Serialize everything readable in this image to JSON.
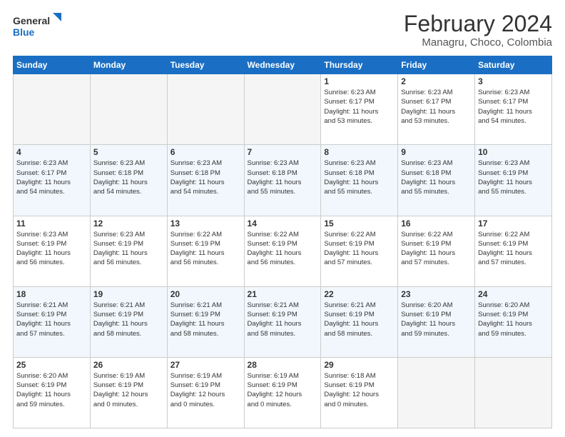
{
  "logo": {
    "text_general": "General",
    "text_blue": "Blue"
  },
  "header": {
    "title": "February 2024",
    "subtitle": "Managru, Choco, Colombia"
  },
  "weekdays": [
    "Sunday",
    "Monday",
    "Tuesday",
    "Wednesday",
    "Thursday",
    "Friday",
    "Saturday"
  ],
  "weeks": [
    [
      {
        "day": "",
        "info": ""
      },
      {
        "day": "",
        "info": ""
      },
      {
        "day": "",
        "info": ""
      },
      {
        "day": "",
        "info": ""
      },
      {
        "day": "1",
        "info": "Sunrise: 6:23 AM\nSunset: 6:17 PM\nDaylight: 11 hours\nand 53 minutes."
      },
      {
        "day": "2",
        "info": "Sunrise: 6:23 AM\nSunset: 6:17 PM\nDaylight: 11 hours\nand 53 minutes."
      },
      {
        "day": "3",
        "info": "Sunrise: 6:23 AM\nSunset: 6:17 PM\nDaylight: 11 hours\nand 54 minutes."
      }
    ],
    [
      {
        "day": "4",
        "info": "Sunrise: 6:23 AM\nSunset: 6:17 PM\nDaylight: 11 hours\nand 54 minutes."
      },
      {
        "day": "5",
        "info": "Sunrise: 6:23 AM\nSunset: 6:18 PM\nDaylight: 11 hours\nand 54 minutes."
      },
      {
        "day": "6",
        "info": "Sunrise: 6:23 AM\nSunset: 6:18 PM\nDaylight: 11 hours\nand 54 minutes."
      },
      {
        "day": "7",
        "info": "Sunrise: 6:23 AM\nSunset: 6:18 PM\nDaylight: 11 hours\nand 55 minutes."
      },
      {
        "day": "8",
        "info": "Sunrise: 6:23 AM\nSunset: 6:18 PM\nDaylight: 11 hours\nand 55 minutes."
      },
      {
        "day": "9",
        "info": "Sunrise: 6:23 AM\nSunset: 6:18 PM\nDaylight: 11 hours\nand 55 minutes."
      },
      {
        "day": "10",
        "info": "Sunrise: 6:23 AM\nSunset: 6:19 PM\nDaylight: 11 hours\nand 55 minutes."
      }
    ],
    [
      {
        "day": "11",
        "info": "Sunrise: 6:23 AM\nSunset: 6:19 PM\nDaylight: 11 hours\nand 56 minutes."
      },
      {
        "day": "12",
        "info": "Sunrise: 6:23 AM\nSunset: 6:19 PM\nDaylight: 11 hours\nand 56 minutes."
      },
      {
        "day": "13",
        "info": "Sunrise: 6:22 AM\nSunset: 6:19 PM\nDaylight: 11 hours\nand 56 minutes."
      },
      {
        "day": "14",
        "info": "Sunrise: 6:22 AM\nSunset: 6:19 PM\nDaylight: 11 hours\nand 56 minutes."
      },
      {
        "day": "15",
        "info": "Sunrise: 6:22 AM\nSunset: 6:19 PM\nDaylight: 11 hours\nand 57 minutes."
      },
      {
        "day": "16",
        "info": "Sunrise: 6:22 AM\nSunset: 6:19 PM\nDaylight: 11 hours\nand 57 minutes."
      },
      {
        "day": "17",
        "info": "Sunrise: 6:22 AM\nSunset: 6:19 PM\nDaylight: 11 hours\nand 57 minutes."
      }
    ],
    [
      {
        "day": "18",
        "info": "Sunrise: 6:21 AM\nSunset: 6:19 PM\nDaylight: 11 hours\nand 57 minutes."
      },
      {
        "day": "19",
        "info": "Sunrise: 6:21 AM\nSunset: 6:19 PM\nDaylight: 11 hours\nand 58 minutes."
      },
      {
        "day": "20",
        "info": "Sunrise: 6:21 AM\nSunset: 6:19 PM\nDaylight: 11 hours\nand 58 minutes."
      },
      {
        "day": "21",
        "info": "Sunrise: 6:21 AM\nSunset: 6:19 PM\nDaylight: 11 hours\nand 58 minutes."
      },
      {
        "day": "22",
        "info": "Sunrise: 6:21 AM\nSunset: 6:19 PM\nDaylight: 11 hours\nand 58 minutes."
      },
      {
        "day": "23",
        "info": "Sunrise: 6:20 AM\nSunset: 6:19 PM\nDaylight: 11 hours\nand 59 minutes."
      },
      {
        "day": "24",
        "info": "Sunrise: 6:20 AM\nSunset: 6:19 PM\nDaylight: 11 hours\nand 59 minutes."
      }
    ],
    [
      {
        "day": "25",
        "info": "Sunrise: 6:20 AM\nSunset: 6:19 PM\nDaylight: 11 hours\nand 59 minutes."
      },
      {
        "day": "26",
        "info": "Sunrise: 6:19 AM\nSunset: 6:19 PM\nDaylight: 12 hours\nand 0 minutes."
      },
      {
        "day": "27",
        "info": "Sunrise: 6:19 AM\nSunset: 6:19 PM\nDaylight: 12 hours\nand 0 minutes."
      },
      {
        "day": "28",
        "info": "Sunrise: 6:19 AM\nSunset: 6:19 PM\nDaylight: 12 hours\nand 0 minutes."
      },
      {
        "day": "29",
        "info": "Sunrise: 6:18 AM\nSunset: 6:19 PM\nDaylight: 12 hours\nand 0 minutes."
      },
      {
        "day": "",
        "info": ""
      },
      {
        "day": "",
        "info": ""
      }
    ]
  ]
}
